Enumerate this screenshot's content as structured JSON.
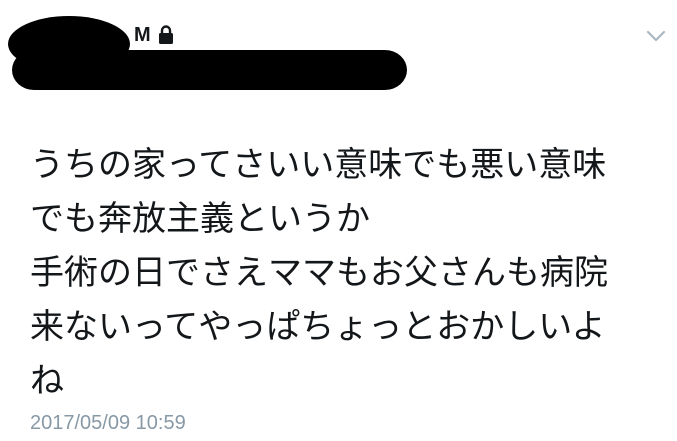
{
  "header": {
    "handle": "M",
    "lock_icon": "lock-icon",
    "menu_icon": "chevron-down-icon"
  },
  "tweet": {
    "lines": [
      "うちの家ってさいい意味でも悪い意味",
      "でも奔放主義というか",
      "手術の日でさえママもお父さんも病院",
      "来ないってやっぱちょっとおかしいよ",
      "ね"
    ],
    "timestamp": "2017/05/09 10:59"
  },
  "colors": {
    "text": "#14171a",
    "muted": "#8899a6",
    "redaction": "#000000"
  }
}
